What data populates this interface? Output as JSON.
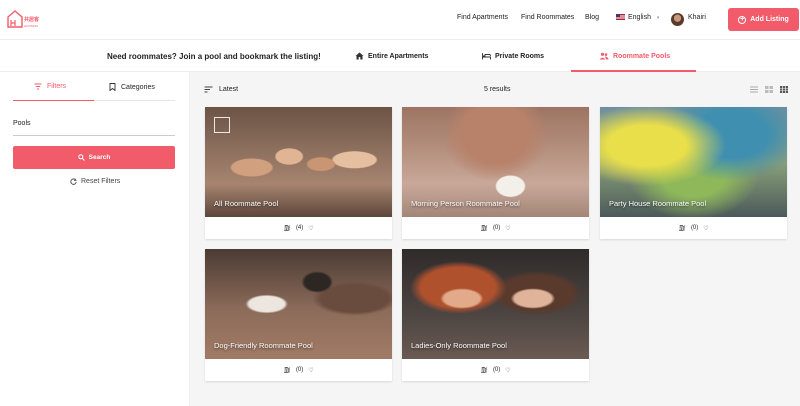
{
  "header": {
    "logo_text": "共居客",
    "logo_sub": "HOUSING",
    "nav": [
      "Find Apartments",
      "Find Roommates",
      "Blog"
    ],
    "language": "English",
    "user_name": "Khairi",
    "add_listing": "Add Listing"
  },
  "subbar": {
    "promo": "Need roommates? Join a pool and bookmark the listing!",
    "tabs": [
      {
        "label": "Entire Apartments",
        "icon": "home-icon"
      },
      {
        "label": "Private Rooms",
        "icon": "bed-icon"
      },
      {
        "label": "Roommate Pools",
        "icon": "users-icon",
        "active": true
      }
    ]
  },
  "sidebar": {
    "tab_filters": "Filters",
    "tab_categories": "Categories",
    "field_label": "Pools",
    "search_label": "Search",
    "reset_label": "Reset Filters"
  },
  "main": {
    "sort_label": "Latest",
    "results": "5 results",
    "cards": [
      {
        "title": "All Roommate Pool",
        "count": "(4)"
      },
      {
        "title": "Morning Person Roommate Pool",
        "count": "(0)"
      },
      {
        "title": "Party House Roommate Pool",
        "count": "(0)"
      },
      {
        "title": "Dog-Friendly Roommate Pool",
        "count": "(0)"
      },
      {
        "title": "Ladies-Only Roommate Pool",
        "count": "(0)"
      }
    ]
  },
  "colors": {
    "accent": "#f25c6a"
  }
}
